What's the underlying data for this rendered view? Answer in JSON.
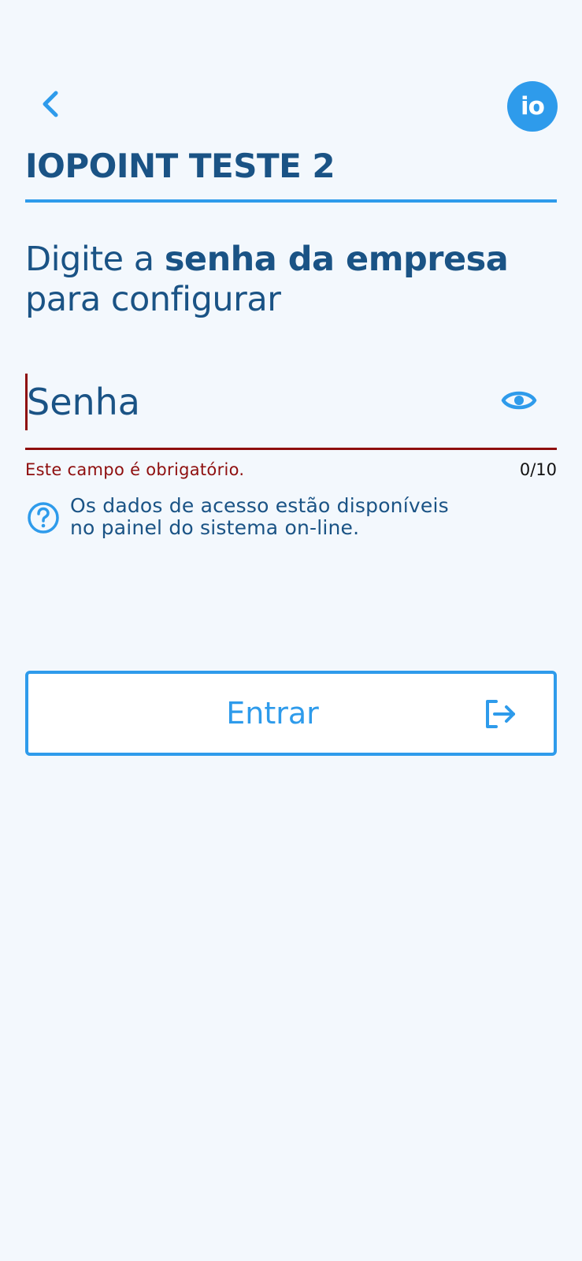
{
  "header": {
    "logo_text": "io",
    "company_name": "IOPOINT TESTE 2"
  },
  "prompt": {
    "prefix": "Digite a ",
    "bold": "senha da empresa",
    "suffix": " para configurar"
  },
  "password_field": {
    "placeholder": "Senha",
    "value": "",
    "error": "Este campo é obrigatório.",
    "counter": "0/10"
  },
  "help": {
    "line1": "Os dados de acesso estão disponíveis",
    "line2": "no painel do sistema on-line."
  },
  "login_button": {
    "label": "Entrar"
  },
  "icons": {
    "back": "chevron-left-icon",
    "visibility": "eye-icon",
    "help": "question-circle-icon",
    "login": "login-arrow-icon"
  },
  "colors": {
    "background": "#F3F8FD",
    "primary": "#2E9BEB",
    "text_dark": "#1A5385",
    "error": "#8E0E0E"
  }
}
